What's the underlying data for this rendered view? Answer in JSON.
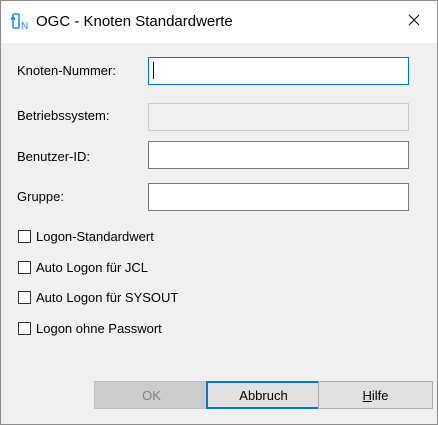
{
  "window": {
    "title": "OGC - Knoten Standardwerte",
    "icon": "ogc-app-icon"
  },
  "titlebar": {
    "close_glyph": "✕"
  },
  "form": {
    "knoten_nummer": {
      "label": "Knoten-Nummer:",
      "value": ""
    },
    "betriebssystem": {
      "label": "Betriebssystem:",
      "value": ""
    },
    "benutzer_id": {
      "label": "Benutzer-ID:",
      "value": ""
    },
    "gruppe": {
      "label": "Gruppe:",
      "value": ""
    }
  },
  "checkboxes": [
    {
      "label": "Logon-Standardwert",
      "checked": false
    },
    {
      "label": "Auto Logon für JCL",
      "checked": false
    },
    {
      "label": "Auto Logon für SYSOUT",
      "checked": false
    },
    {
      "label": "Logon ohne Passwort",
      "checked": false
    }
  ],
  "buttons": {
    "ok": "OK",
    "abbruch": "Abbruch",
    "hilfe_mnemonic": "H",
    "hilfe_rest": "ilfe"
  },
  "colors": {
    "accent": "#0078d7",
    "dialog_bg": "#f0f0f0",
    "icon_blue": "#1e90ff"
  }
}
